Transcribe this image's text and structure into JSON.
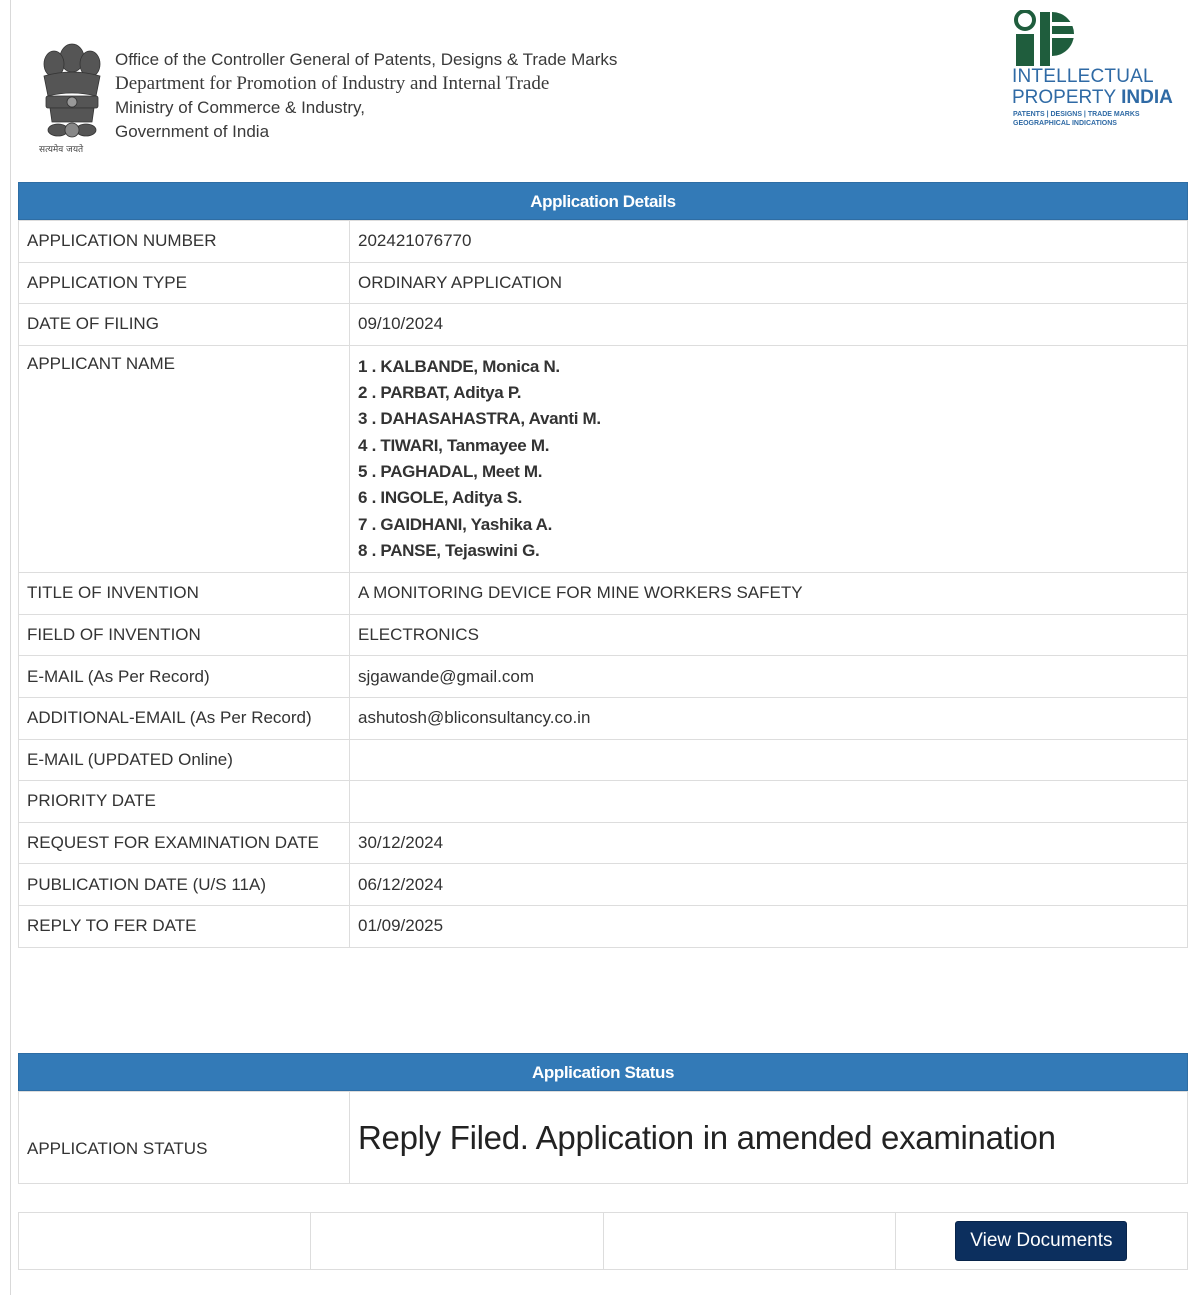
{
  "header": {
    "emblem_caption": "सत्यमेव जयते",
    "org_lines": [
      "Office of the Controller General of Patents, Designs & Trade Marks",
      "Department for Promotion of Industry and Internal Trade",
      "Ministry of Commerce & Industry,",
      "Government of India"
    ],
    "logo": {
      "line1": "INTELLECTUAL",
      "line2a": "PROPERTY ",
      "line2b": "INDIA",
      "line3": "PATENTS | DESIGNS | TRADE MARKS",
      "line4": "GEOGRAPHICAL INDICATIONS"
    }
  },
  "details": {
    "title": "Application Details",
    "rows": [
      {
        "label": "APPLICATION NUMBER",
        "value": "202421076770"
      },
      {
        "label": "APPLICATION TYPE",
        "value": "ORDINARY APPLICATION"
      },
      {
        "label": "DATE OF FILING",
        "value": "09/10/2024"
      }
    ],
    "applicant_label": "APPLICANT NAME",
    "applicants": [
      "1 . KALBANDE, Monica N.",
      "2 . PARBAT, Aditya P.",
      "3 . DAHASAHASTRA, Avanti M.",
      "4 . TIWARI, Tanmayee M.",
      "5 . PAGHADAL, Meet M.",
      "6 . INGOLE, Aditya S.",
      "7 . GAIDHANI, Yashika A.",
      "8 . PANSE, Tejaswini G."
    ],
    "rows2": [
      {
        "label": "TITLE OF INVENTION",
        "value": "A MONITORING DEVICE FOR MINE WORKERS SAFETY"
      },
      {
        "label": "FIELD OF INVENTION",
        "value": "ELECTRONICS"
      },
      {
        "label": "E-MAIL (As Per Record)",
        "value": "sjgawande@gmail.com"
      },
      {
        "label": "ADDITIONAL-EMAIL (As Per Record)",
        "value": "ashutosh@bliconsultancy.co.in"
      },
      {
        "label": "E-MAIL (UPDATED Online)",
        "value": ""
      },
      {
        "label": "PRIORITY DATE",
        "value": ""
      },
      {
        "label": "REQUEST FOR EXAMINATION DATE",
        "value": "30/12/2024"
      },
      {
        "label": "PUBLICATION DATE (U/S 11A)",
        "value": "06/12/2024"
      },
      {
        "label": "REPLY TO FER DATE",
        "value": "01/09/2025"
      }
    ]
  },
  "status": {
    "title": "Application Status",
    "label": "APPLICATION STATUS",
    "value": "Reply Filed. Application in amended examination"
  },
  "actions": {
    "view_documents_label": "View Documents"
  },
  "colors": {
    "panel_header": "#337ab7",
    "button": "#0c2f5e",
    "logo_blue": "#2f6aa5"
  }
}
